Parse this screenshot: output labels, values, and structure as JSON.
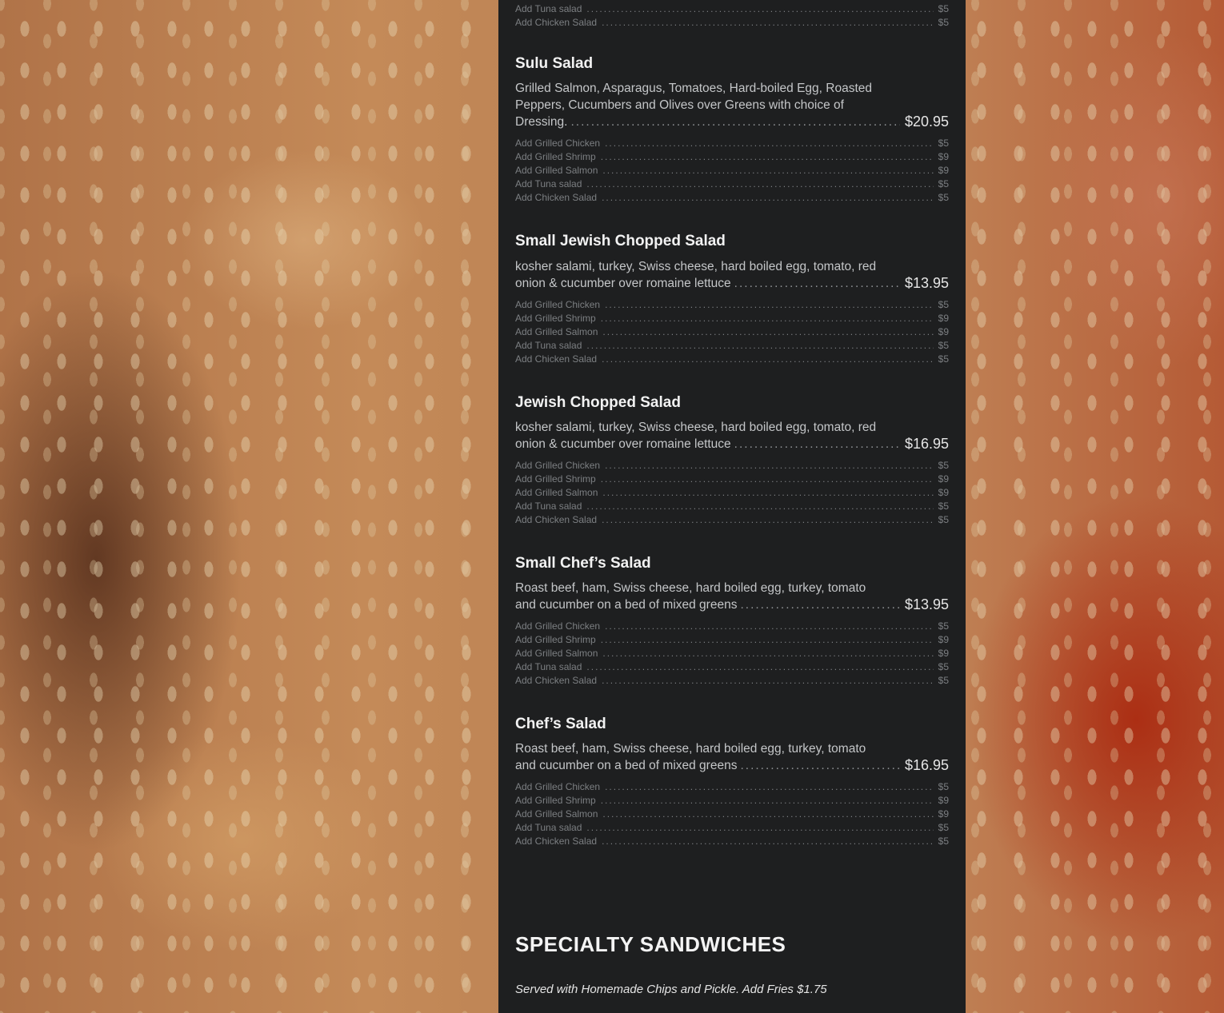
{
  "menu": {
    "top_addons": [
      {
        "label": "Add Tuna salad",
        "price": "$5"
      },
      {
        "label": "Add Chicken Salad",
        "price": "$5"
      }
    ],
    "items": [
      {
        "name": "Sulu Salad",
        "desc_lines": [
          "Grilled Salmon, Asparagus, Tomatoes, Hard-boiled Egg, Roasted",
          "Peppers, Cucumbers and Olives over Greens with choice of"
        ],
        "desc_last": "Dressing.",
        "price": "$20.95",
        "addons": [
          {
            "label": "Add Grilled Chicken",
            "price": "$5"
          },
          {
            "label": "Add Grilled Shrimp",
            "price": "$9"
          },
          {
            "label": "Add Grilled Salmon",
            "price": "$9"
          },
          {
            "label": "Add Tuna salad",
            "price": "$5"
          },
          {
            "label": "Add Chicken Salad",
            "price": "$5"
          }
        ]
      },
      {
        "name": "Small Jewish Chopped Salad",
        "desc_lines": [
          "kosher salami, turkey, Swiss cheese, hard boiled egg, tomato, red"
        ],
        "desc_last": "onion & cucumber over romaine lettuce",
        "price": "$13.95",
        "addons": [
          {
            "label": "Add Grilled Chicken",
            "price": "$5"
          },
          {
            "label": "Add Grilled Shrimp",
            "price": "$9"
          },
          {
            "label": "Add Grilled Salmon",
            "price": "$9"
          },
          {
            "label": "Add Tuna salad",
            "price": "$5"
          },
          {
            "label": "Add Chicken Salad",
            "price": "$5"
          }
        ]
      },
      {
        "name": "Jewish Chopped Salad",
        "desc_lines": [
          "kosher salami, turkey, Swiss cheese, hard boiled egg, tomato, red"
        ],
        "desc_last": "onion & cucumber over romaine lettuce",
        "price": "$16.95",
        "addons": [
          {
            "label": "Add Grilled Chicken",
            "price": "$5"
          },
          {
            "label": "Add Grilled Shrimp",
            "price": "$9"
          },
          {
            "label": "Add Grilled Salmon",
            "price": "$9"
          },
          {
            "label": "Add Tuna salad",
            "price": "$5"
          },
          {
            "label": "Add Chicken Salad",
            "price": "$5"
          }
        ]
      },
      {
        "name": "Small Chef’s Salad",
        "desc_lines": [
          "Roast beef, ham, Swiss cheese, hard boiled egg, turkey, tomato"
        ],
        "desc_last": "and cucumber on a bed of mixed greens",
        "price": "$13.95",
        "addons": [
          {
            "label": "Add Grilled Chicken",
            "price": "$5"
          },
          {
            "label": "Add Grilled Shrimp",
            "price": "$9"
          },
          {
            "label": "Add Grilled Salmon",
            "price": "$9"
          },
          {
            "label": "Add Tuna salad",
            "price": "$5"
          },
          {
            "label": "Add Chicken Salad",
            "price": "$5"
          }
        ]
      },
      {
        "name": "Chef’s Salad",
        "desc_lines": [
          "Roast beef, ham, Swiss cheese, hard boiled egg, turkey, tomato"
        ],
        "desc_last": "and cucumber on a bed of mixed greens",
        "price": "$16.95",
        "addons": [
          {
            "label": "Add Grilled Chicken",
            "price": "$5"
          },
          {
            "label": "Add Grilled Shrimp",
            "price": "$9"
          },
          {
            "label": "Add Grilled Salmon",
            "price": "$9"
          },
          {
            "label": "Add Tuna salad",
            "price": "$5"
          },
          {
            "label": "Add Chicken Salad",
            "price": "$5"
          }
        ]
      }
    ],
    "next_section": {
      "title": "SPECIALTY SANDWICHES",
      "note": "Served with Homemade Chips and Pickle. Add Fries $1.75"
    }
  },
  "colors": {
    "panel_bg": "#1e1f20",
    "item_name": "#f2f2f2",
    "description": "#c4c6c8",
    "addon_text": "#7c7f82",
    "price": "#e6e6e6"
  }
}
